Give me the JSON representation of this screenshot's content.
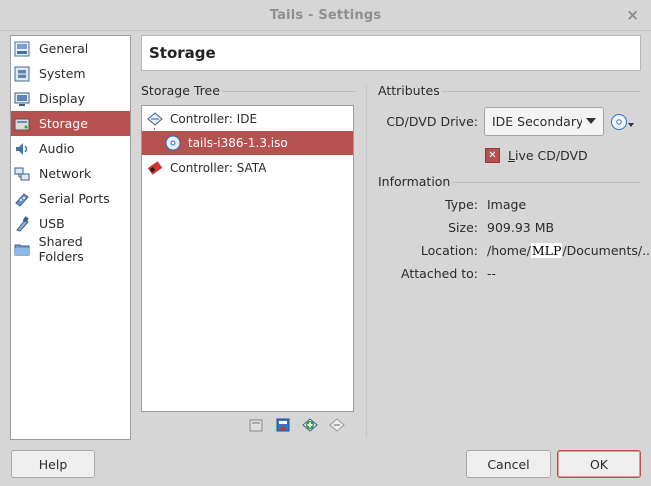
{
  "window": {
    "title": "Tails - Settings",
    "close_glyph": "×"
  },
  "nav": {
    "items": [
      {
        "label": "General",
        "icon": "general-icon"
      },
      {
        "label": "System",
        "icon": "system-icon"
      },
      {
        "label": "Display",
        "icon": "display-icon"
      },
      {
        "label": "Storage",
        "icon": "storage-icon",
        "selected": true
      },
      {
        "label": "Audio",
        "icon": "audio-icon"
      },
      {
        "label": "Network",
        "icon": "network-icon"
      },
      {
        "label": "Serial Ports",
        "icon": "serial-ports-icon"
      },
      {
        "label": "USB",
        "icon": "usb-icon"
      },
      {
        "label": "Shared Folders",
        "icon": "shared-folders-icon"
      }
    ]
  },
  "header": {
    "title": "Storage"
  },
  "storage_tree": {
    "label": "Storage Tree",
    "rows": [
      {
        "label": "Controller: IDE",
        "icon": "ide-controller-icon"
      },
      {
        "label": "tails-i386-1.3.iso",
        "icon": "optical-disc-icon",
        "selected": true
      },
      {
        "label": "Controller: SATA",
        "icon": "sata-controller-icon"
      }
    ],
    "tools": [
      "add-attachment-icon",
      "remove-attachment-icon",
      "add-controller-icon",
      "remove-controller-icon"
    ]
  },
  "attributes": {
    "label": "Attributes",
    "drive_label": "CD/DVD Drive:",
    "drive_value": "IDE Secondary M",
    "live_cd_label": "Live CD/DVD",
    "live_cd_checked": true
  },
  "information": {
    "label": "Information",
    "type_label": "Type:",
    "type_value": "Image",
    "size_label": "Size:",
    "size_value": "909.93 MB",
    "location_label": "Location:",
    "location_prefix": "/home/",
    "location_redacted": "MLP",
    "location_suffix": "/Documents/...",
    "attached_label": "Attached to:",
    "attached_value": "--"
  },
  "buttons": {
    "help": "Help",
    "cancel": "Cancel",
    "ok": "OK"
  },
  "colors": {
    "accent": "#b5514f",
    "background": "#d6d6d6"
  }
}
